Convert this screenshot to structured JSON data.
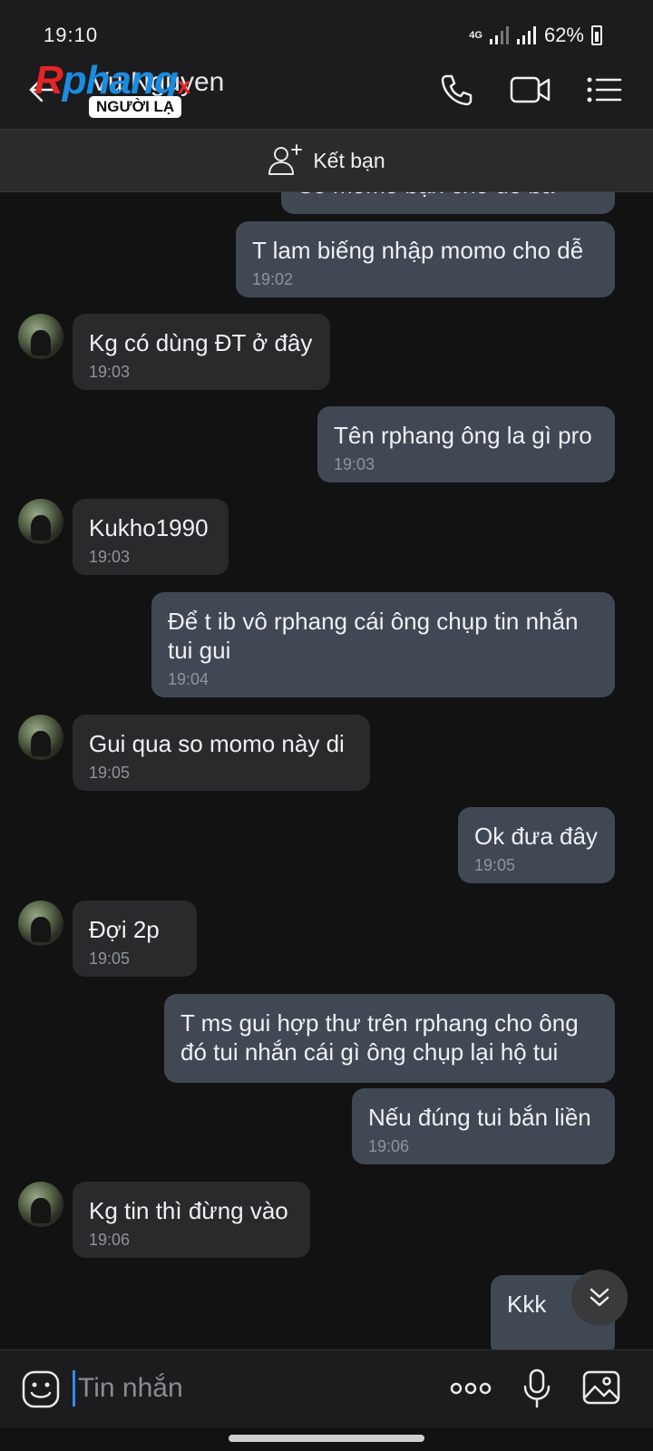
{
  "status_bar": {
    "time": "19:10",
    "network": "4G",
    "battery": "62%"
  },
  "header": {
    "logo": {
      "r": "R",
      "main": "phang",
      "x": "x"
    },
    "contact_name": "Vu Nguyen",
    "badge": "NGƯỜI LẠ",
    "icons": [
      "back-arrow-icon",
      "phone-icon",
      "video-call-icon",
      "menu-list-icon"
    ]
  },
  "add_friend": {
    "label": "Kết bạn",
    "icon": "add-friend-icon"
  },
  "messages": [
    {
      "side": "sent",
      "text": "Số momo bạn cho dễ bấ",
      "time": ""
    },
    {
      "side": "sent",
      "text": "T lam biếng nhập momo cho dễ",
      "time": "19:02"
    },
    {
      "side": "recv",
      "text": "Kg có dùng ĐT ở đây",
      "time": "19:03"
    },
    {
      "side": "sent",
      "text": "Tên rphang ông la gì pro",
      "time": "19:03"
    },
    {
      "side": "recv",
      "text": "Kukho1990",
      "time": "19:03"
    },
    {
      "side": "sent",
      "text": "Để t ib vô rphang cái ông chụp tin nhắn tui gui",
      "time": "19:04"
    },
    {
      "side": "recv",
      "text": "Gui qua so momo này di",
      "time": "19:05"
    },
    {
      "side": "sent",
      "text": "Ok đưa đây",
      "time": "19:05"
    },
    {
      "side": "recv",
      "text": "Đợi 2p",
      "time": "19:05"
    },
    {
      "side": "sent",
      "text": "T ms gui hợp thư trên rphang cho ông đó tui nhắn cái gì ông chụp lại hộ tui",
      "time": ""
    },
    {
      "side": "sent",
      "text": "Nếu đúng tui bắn liền",
      "time": "19:06"
    },
    {
      "side": "recv",
      "text": "Kg tin thì đừng vào",
      "time": "19:06"
    },
    {
      "side": "sent",
      "text": "Kkk",
      "time": ""
    }
  ],
  "composer": {
    "placeholder": "Tin nhắn",
    "icons": [
      "emoji-icon",
      "more-options-icon",
      "microphone-icon",
      "image-icon"
    ]
  },
  "colors": {
    "sent_bubble": "#404854",
    "recv_bubble": "#2a2a2c",
    "background": "#121212",
    "accent": "#2d8cf0"
  }
}
